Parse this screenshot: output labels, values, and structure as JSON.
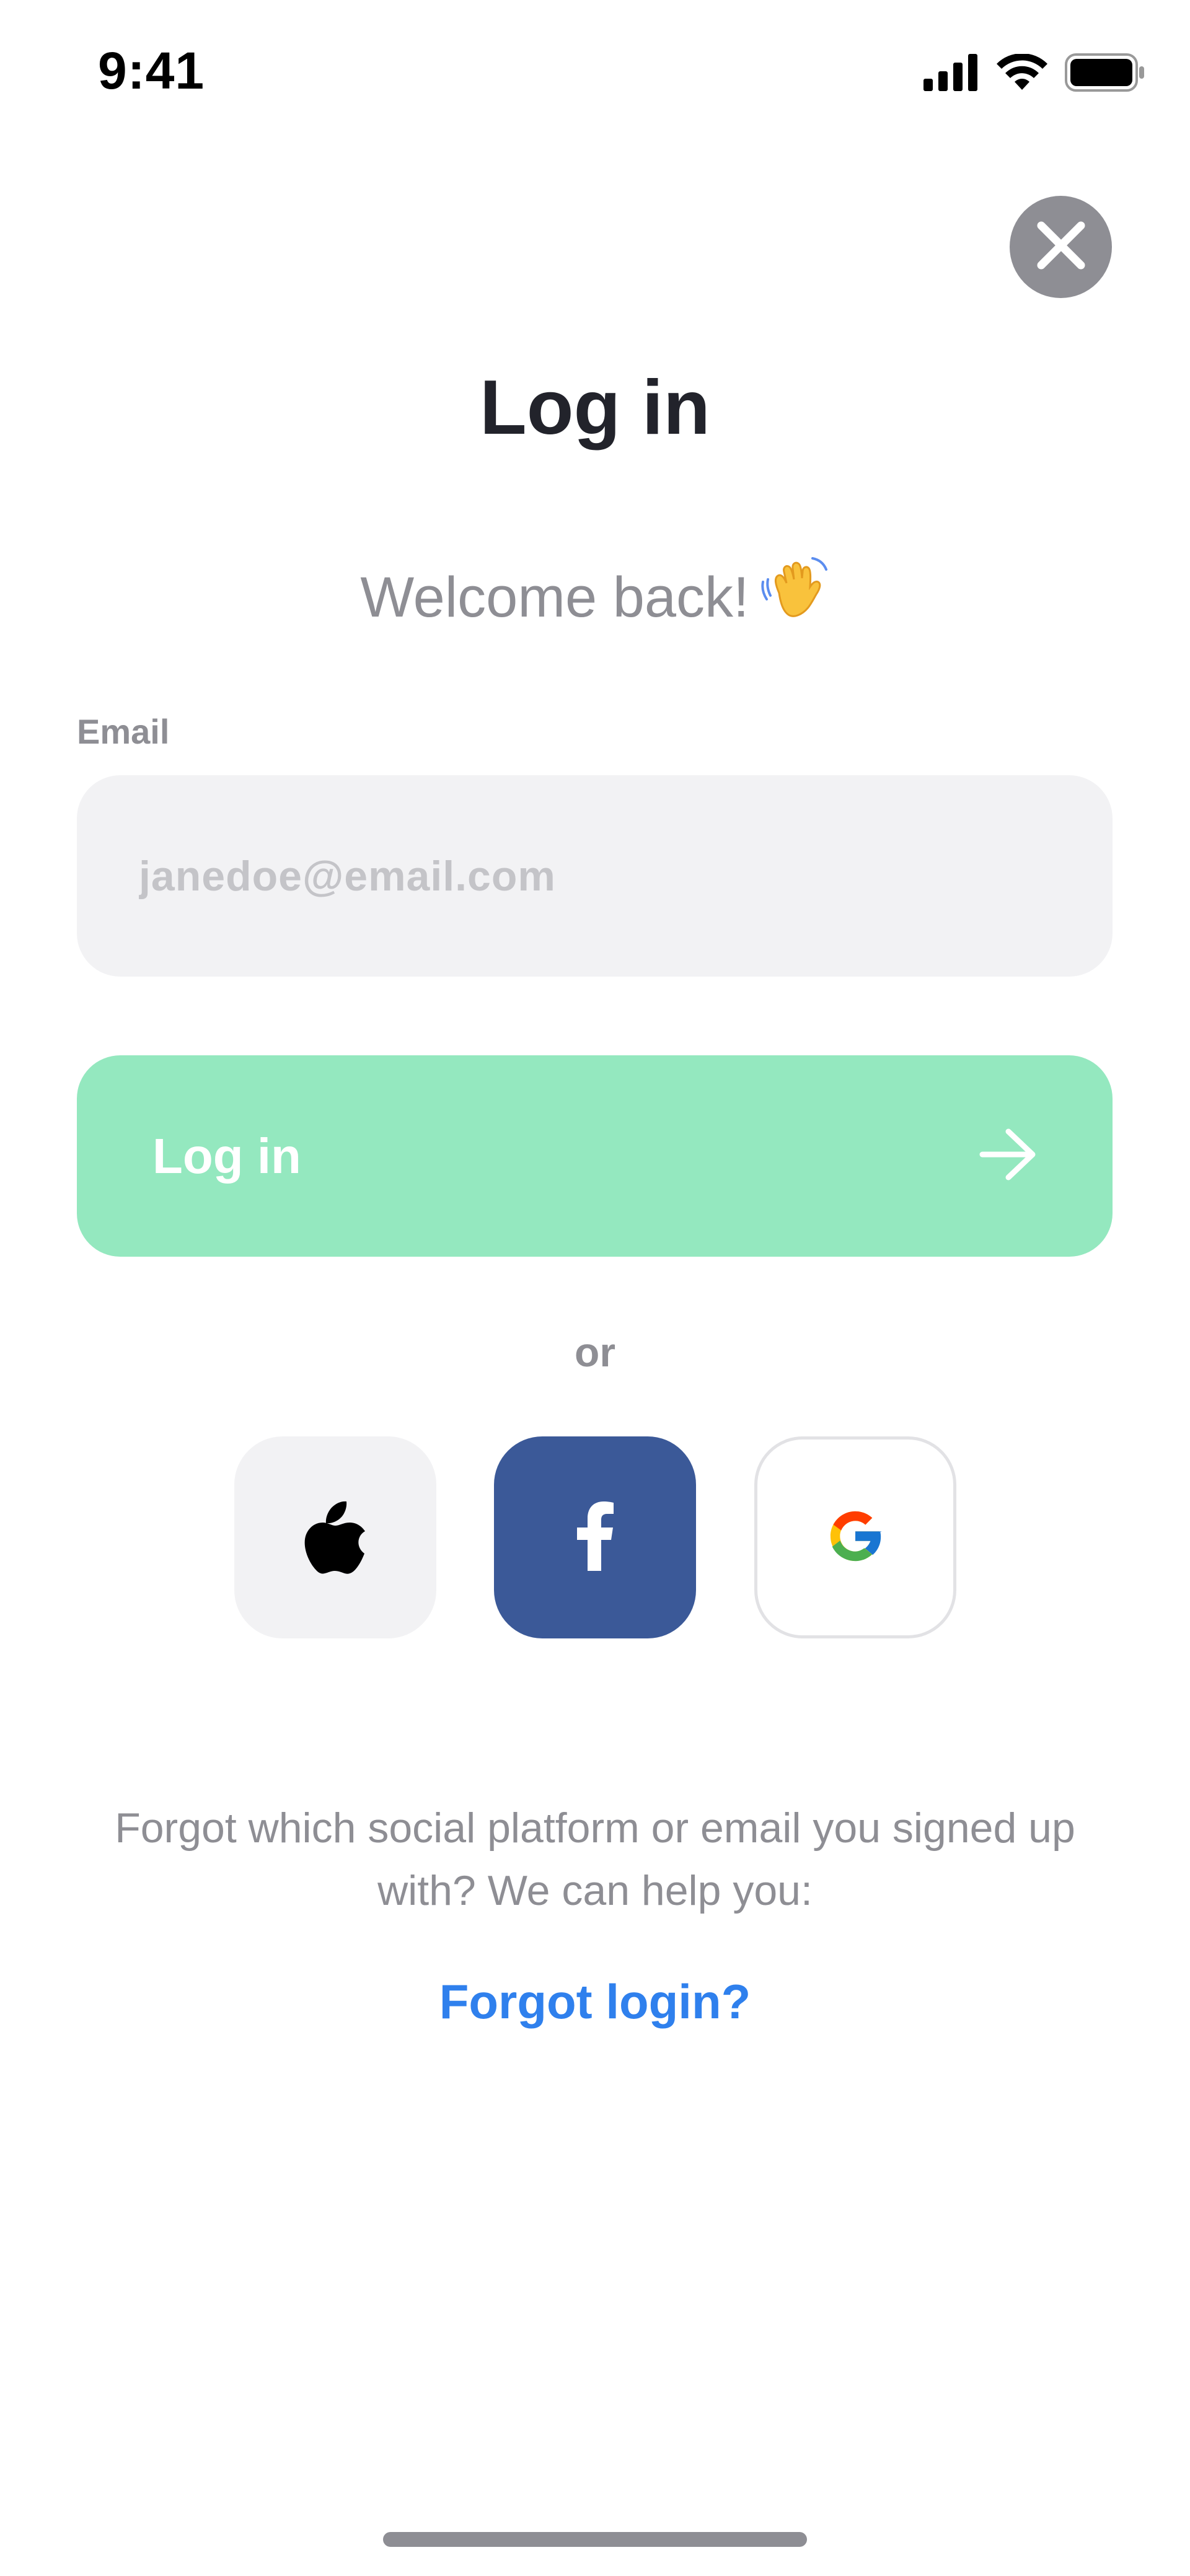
{
  "status_bar": {
    "time": "9:41"
  },
  "header": {
    "title": "Log in",
    "subtitle": "Welcome back!",
    "close_icon": "close-icon"
  },
  "form": {
    "email_label": "Email",
    "email_placeholder": "janedoe@email.com",
    "email_value": "",
    "submit_label": "Log in"
  },
  "divider_text": "or",
  "social": {
    "providers": [
      "apple",
      "facebook",
      "google"
    ],
    "facebook_color": "#3b5998"
  },
  "help": {
    "text": "Forgot which social platform or email you signed up with? We can help you:",
    "link_label": "Forgot login?"
  },
  "colors": {
    "primary_button": "#94e8bf",
    "link": "#2f80ed",
    "muted_text": "#8e8e94",
    "input_bg": "#f2f2f4"
  }
}
